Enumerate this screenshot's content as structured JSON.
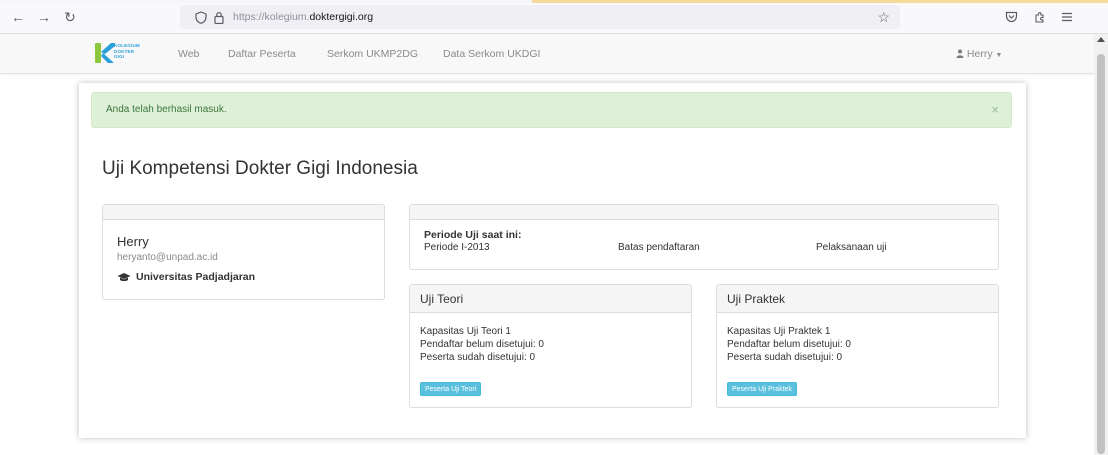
{
  "browser": {
    "url_prefix": "https://kolegium.",
    "url_domain": "doktergigi.org"
  },
  "site_nav": {
    "logo_lines": [
      "KOLEGIUM",
      "DOKTER",
      "GIGI"
    ],
    "links": [
      "Web",
      "Daftar Peserta",
      "Serkom UKMP2DG",
      "Data Serkom UKDGI"
    ],
    "user_label": "Herry"
  },
  "alert": {
    "message": "Anda telah berhasil masuk.",
    "close": "×"
  },
  "page_title": "Uji Kompetensi Dokter Gigi Indonesia",
  "profile": {
    "name": "Herry",
    "email": "heryanto@unpad.ac.id",
    "university": "Universitas Padjadjaran"
  },
  "periode": {
    "label": "Periode Uji saat ini:",
    "value": "Periode I-2013",
    "batas": "Batas pendaftaran",
    "pelaksanaan": "Pelaksanaan uji"
  },
  "uji_teori": {
    "title": "Uji Teori",
    "kapasitas": "Kapasitas Uji Teori 1",
    "belum": "Pendaftar belum disetujui: 0",
    "sudah": "Peserta sudah disetujui: 0",
    "button": "Peserta Uji Teori"
  },
  "uji_praktek": {
    "title": "Uji Praktek",
    "kapasitas": "Kapasitas Uji Praktek 1",
    "belum": "Pendaftar belum disetujui: 0",
    "sudah": "Peserta sudah disetujui: 0",
    "button": "Peserta Uji Praktek"
  },
  "colors": {
    "alert_bg": "#dff0d8",
    "alert_text": "#3c763d",
    "button_info": "#5bc0de",
    "logo_blue": "#2b9fd9",
    "logo_green": "#8dc63f"
  }
}
